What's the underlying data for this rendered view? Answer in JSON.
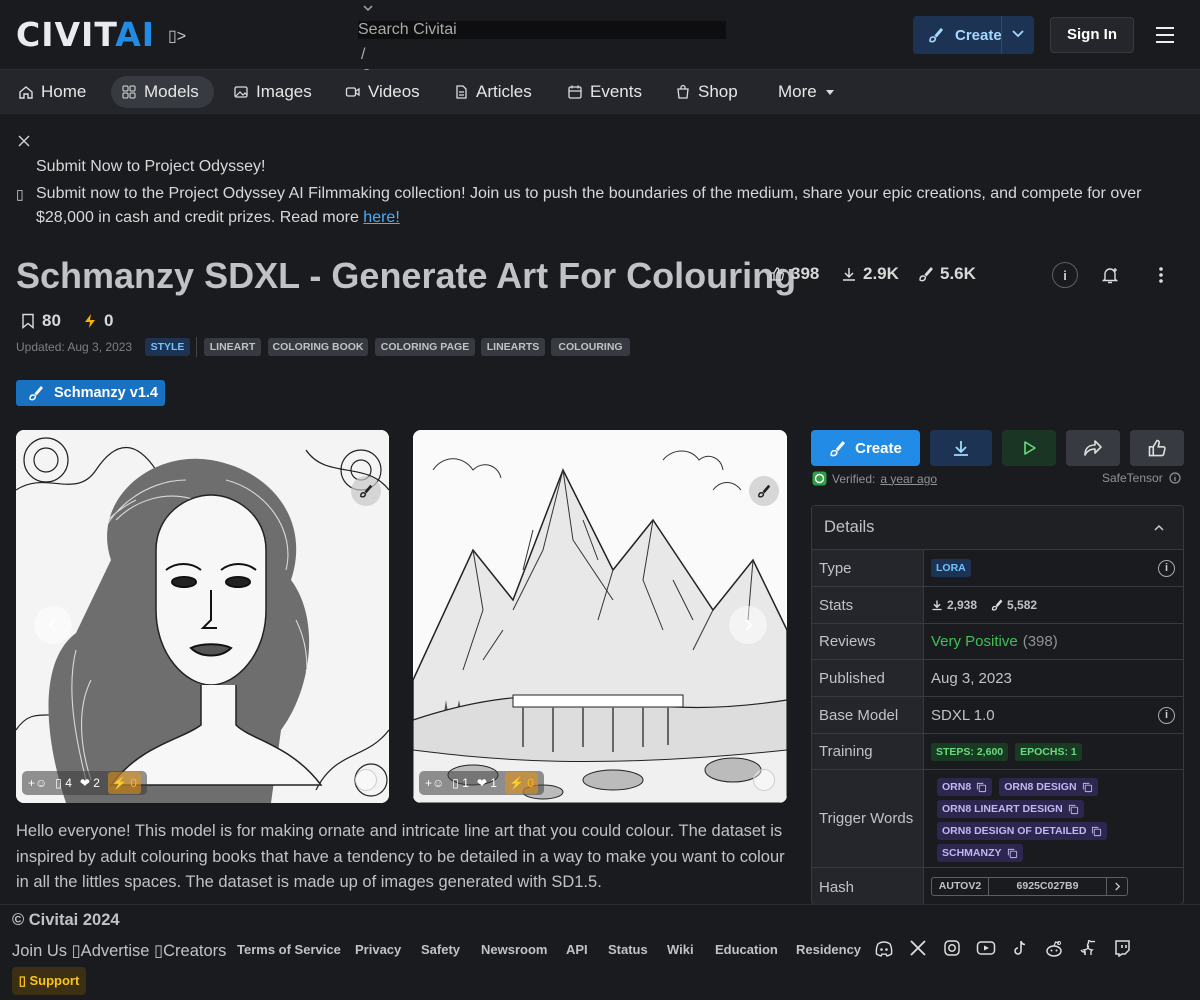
{
  "header": {
    "logo_civ": "CIVIT",
    "logo_ai": "AI",
    "logo_ext": "▯>",
    "search_placeholder": "Search Civitai",
    "search_shortcut": "/",
    "create_label": "Create",
    "signin_label": "Sign In"
  },
  "nav": {
    "items": [
      {
        "label": "Home",
        "icon": "home-icon"
      },
      {
        "label": "Models",
        "icon": "grid-icon"
      },
      {
        "label": "Images",
        "icon": "photo-icon"
      },
      {
        "label": "Videos",
        "icon": "video-icon"
      },
      {
        "label": "Articles",
        "icon": "file-text-icon"
      },
      {
        "label": "Events",
        "icon": "calendar-icon"
      },
      {
        "label": "Shop",
        "icon": "shopping-bag-icon"
      },
      {
        "label": "More",
        "icon": "caret-down-icon"
      }
    ],
    "active": "Models"
  },
  "announcement": {
    "title": "Submit Now to Project Odyssey!",
    "icon_glyph": "▯",
    "body": "Submit now to the Project Odyssey AI Filmmaking collection! Join us to push the boundaries of the medium, share your epic creations, and compete for over $28,000 in cash and credit prizes. Read more ",
    "link": "here!"
  },
  "model": {
    "title": "Schmanzy SDXL - Generate Art For Colouring",
    "likes": "398",
    "downloads": "2.9K",
    "generations": "5.6K",
    "collected": "80",
    "buzz": "0",
    "updated": "Updated: Aug 3, 2023",
    "tags": [
      "STYLE",
      "LINEART",
      "COLORING BOOK",
      "COLORING PAGE",
      "LINEARTS",
      "COLOURING"
    ],
    "version": "Schmanzy v1.4",
    "description": "Hello everyone! This model is for making ornate and intricate line art that you could colour. The dataset is inspired by adult colouring books that have a tendency to be detailed in a way to make you want to colour in all the littles spaces. The dataset is made up of images generated with SD1.5."
  },
  "gallery": [
    {
      "subject": "woman portrait line art",
      "glyph": "▯",
      "comments": "4",
      "hearts": "2",
      "buzz": "0"
    },
    {
      "subject": "mountain waterfall line art",
      "glyph": "▯",
      "comments": "1",
      "hearts": "1",
      "buzz": "0"
    }
  ],
  "actions": {
    "create_label": "Create",
    "verified_label": "Verified:",
    "verified_time": "a year ago",
    "safetensor_label": "SafeTensor"
  },
  "details": {
    "heading": "Details",
    "rows": {
      "type_label": "Type",
      "type_value": "LORA",
      "stats_label": "Stats",
      "stats_downloads": "2,938",
      "stats_generations": "5,582",
      "reviews_label": "Reviews",
      "reviews_value": "Very Positive",
      "reviews_count": "(398)",
      "published_label": "Published",
      "published_value": "Aug 3, 2023",
      "base_label": "Base Model",
      "base_value": "SDXL 1.0",
      "training_label": "Training",
      "steps": "STEPS: 2,600",
      "epochs": "EPOCHS: 1",
      "trigger_label": "Trigger Words",
      "trigger_words": [
        "ORN8",
        "ORN8 DESIGN",
        "ORN8 LINEART DESIGN",
        "ORN8 DESIGN OF DETAILED",
        "SCHMANZY"
      ],
      "hash_label": "Hash",
      "hash_type": "AUTOV2",
      "hash_value": "6925C027B9"
    },
    "colors": {
      "positive": "#40c057",
      "accent": "#228be6"
    }
  },
  "footer": {
    "copyright": "© Civitai 2024",
    "join": "Join Us ▯Advertise ▯Creators",
    "links": [
      "Terms of Service",
      "Privacy",
      "Safety",
      "Newsroom",
      "API",
      "Status",
      "Wiki",
      "Education",
      "Residency"
    ],
    "support": "▯ Support",
    "social_icons": [
      "discord-icon",
      "x-icon",
      "instagram-icon",
      "youtube-icon",
      "tiktok-icon",
      "reddit-icon",
      "github-icon",
      "twitch-icon"
    ]
  }
}
